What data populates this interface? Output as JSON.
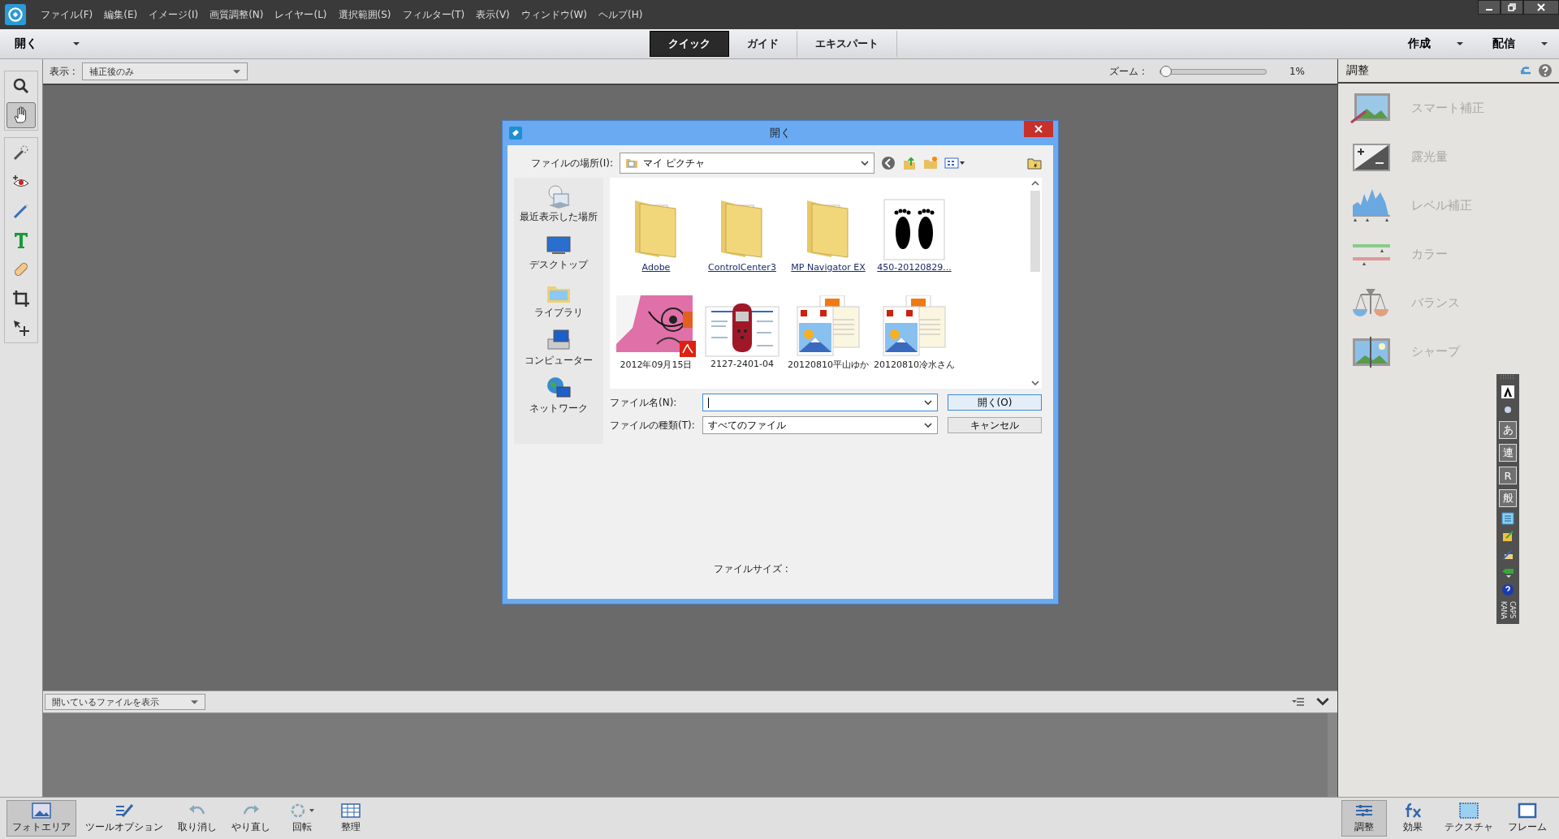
{
  "menu": [
    "ファイル(F)",
    "編集(E)",
    "イメージ(I)",
    "画質調整(N)",
    "レイヤー(L)",
    "選択範囲(S)",
    "フィルター(T)",
    "表示(V)",
    "ウィンドウ(W)",
    "ヘルプ(H)"
  ],
  "mode_bar": {
    "open_label": "開く",
    "modes": [
      {
        "label": "クイック",
        "selected": true
      },
      {
        "label": "ガイド",
        "selected": false
      },
      {
        "label": "エキスパート",
        "selected": false
      }
    ],
    "actions": [
      "作成",
      "配信"
    ]
  },
  "options_bar": {
    "view_label": "表示 :",
    "view_value": "補正後のみ",
    "zoom_label": "ズーム :",
    "zoom": {
      "level": 0.0
    },
    "zoom_value": "1%"
  },
  "tools": [
    {
      "kind": "zoom",
      "selected": false
    },
    {
      "kind": "hand",
      "selected": true
    },
    {
      "kind": "quick-select",
      "selected": false
    },
    {
      "kind": "eye",
      "selected": false
    },
    {
      "kind": "whiten",
      "selected": false
    },
    {
      "kind": "text",
      "selected": false
    },
    {
      "kind": "heal",
      "selected": false
    },
    {
      "kind": "crop",
      "selected": false
    },
    {
      "kind": "move",
      "selected": false
    }
  ],
  "dialog": {
    "title": "開く",
    "location_label": "ファイルの場所(I):",
    "location": "マイ ピクチャ",
    "places": [
      {
        "kind": "recent",
        "label": "最近表示した場所"
      },
      {
        "kind": "desktop",
        "label": "デスクトップ"
      },
      {
        "kind": "library",
        "label": "ライブラリ"
      },
      {
        "kind": "computer",
        "label": "コンピューター"
      },
      {
        "kind": "network",
        "label": "ネットワーク"
      }
    ],
    "files": [
      {
        "kind": "folder",
        "name": "Adobe"
      },
      {
        "kind": "folder",
        "name": "ControlCenter3"
      },
      {
        "kind": "folder",
        "name": "MP Navigator EX"
      },
      {
        "name": "450-20120829..."
      },
      {
        "kind": "pdf",
        "name": "2012年09月15日"
      },
      {
        "kind": "doc",
        "name": "2127-2401-04"
      },
      {
        "kind": "card",
        "name": "20120810平山ゆか"
      },
      {
        "kind": "card",
        "name": "20120810冷水さん"
      }
    ],
    "filename_label": "ファイル名(N):",
    "filetype_label": "ファイルの種類(T):",
    "filetype": "すべてのファイル",
    "buttons": [
      "開く(O)",
      "キャンセル"
    ],
    "file_size_label": "ファイルサイズ :"
  },
  "bin": {
    "view": "開いているファイルを表示"
  },
  "panel": {
    "title": "調整",
    "items": [
      {
        "kind": "smart",
        "label": "スマート補正"
      },
      {
        "kind": "exposure",
        "label": "露光量"
      },
      {
        "kind": "levels",
        "label": "レベル補正"
      },
      {
        "kind": "color",
        "label": "カラー"
      },
      {
        "kind": "balance",
        "label": "バランス"
      },
      {
        "kind": "sharpen",
        "label": "シャープ"
      }
    ]
  },
  "ime_bar": {
    "keys": [
      "あ",
      "連",
      "R",
      "般"
    ],
    "modes": [
      "KANA",
      "CAPS"
    ]
  },
  "bottom_left": [
    {
      "kind": "photo-area",
      "label": "フォトエリア",
      "selected": true
    },
    {
      "kind": "tool-options",
      "label": "ツールオプション",
      "selected": false
    },
    {
      "kind": "undo",
      "label": "取り消し",
      "selected": false
    },
    {
      "kind": "redo",
      "label": "やり直し",
      "selected": false
    },
    {
      "kind": "rotate",
      "label": "回転",
      "selected": false
    },
    {
      "kind": "organize",
      "label": "整理",
      "selected": false
    }
  ],
  "bottom_right": [
    {
      "kind": "adjust",
      "label": "調整",
      "selected": true
    },
    {
      "kind": "effects",
      "label": "効果",
      "selected": false
    },
    {
      "kind": "texture",
      "label": "テクスチャ",
      "selected": false
    },
    {
      "kind": "frame",
      "label": "フレーム",
      "selected": false
    }
  ]
}
